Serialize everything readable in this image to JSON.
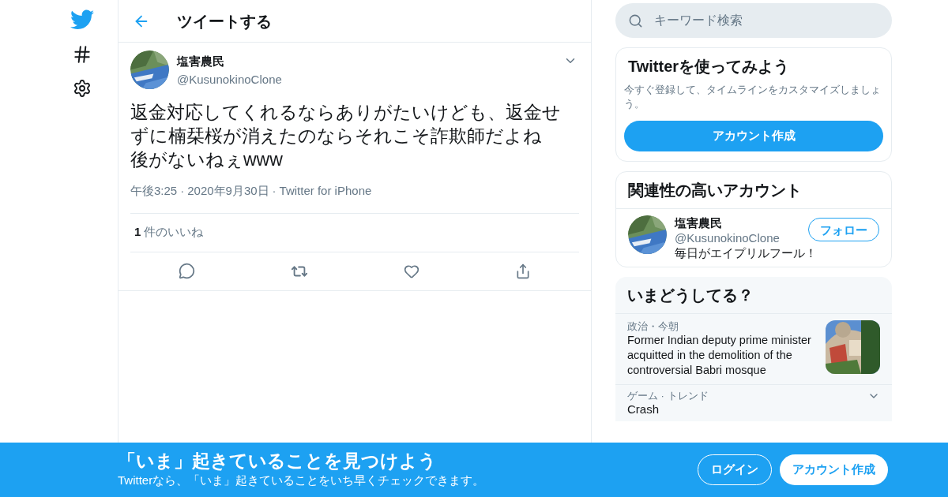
{
  "header": {
    "title": "ツイートする"
  },
  "tweet": {
    "name": "塩害農民",
    "handle": "@KusunokinoClone",
    "lines": [
      "返金対応してくれるならありがたいけども、返金せずに楠栞桜が消えたのならそれこそ詐欺師だよね",
      "後がないねぇwww"
    ],
    "time": "午後3:25",
    "separator": "·",
    "date": "2020年9月30日",
    "source": "Twitter for iPhone",
    "like_count": "1",
    "like_label": "件のいいね"
  },
  "search": {
    "placeholder": "キーワード検索"
  },
  "signup_card": {
    "title": "Twitterを使ってみよう",
    "text": "今すぐ登録して、タイムラインをカスタマイズしましょう。",
    "button": "アカウント作成"
  },
  "related": {
    "title": "関連性の高いアカウント",
    "accounts": [
      {
        "name": "塩害農民",
        "handle": "@KusunokinoClone",
        "bio": "毎日がエイプリルフール！",
        "button": "フォロー"
      }
    ]
  },
  "trends": {
    "title": "いまどうしてる？",
    "items": [
      {
        "kind": "news",
        "meta": "政治・今朝",
        "text": "Former Indian deputy prime minister acquitted in the demolition of the controversial Babri mosque"
      },
      {
        "kind": "trend",
        "meta": "ゲーム · トレンド",
        "text": "Crash"
      }
    ]
  },
  "banner": {
    "title": "「いま」起きていることを見つけよう",
    "subtitle": "Twitterなら、「いま」起きていることをいち早くチェックできます。",
    "buttons": [
      {
        "kind": "outline",
        "label": "ログイン"
      },
      {
        "kind": "filled",
        "label": "アカウント作成"
      }
    ]
  }
}
